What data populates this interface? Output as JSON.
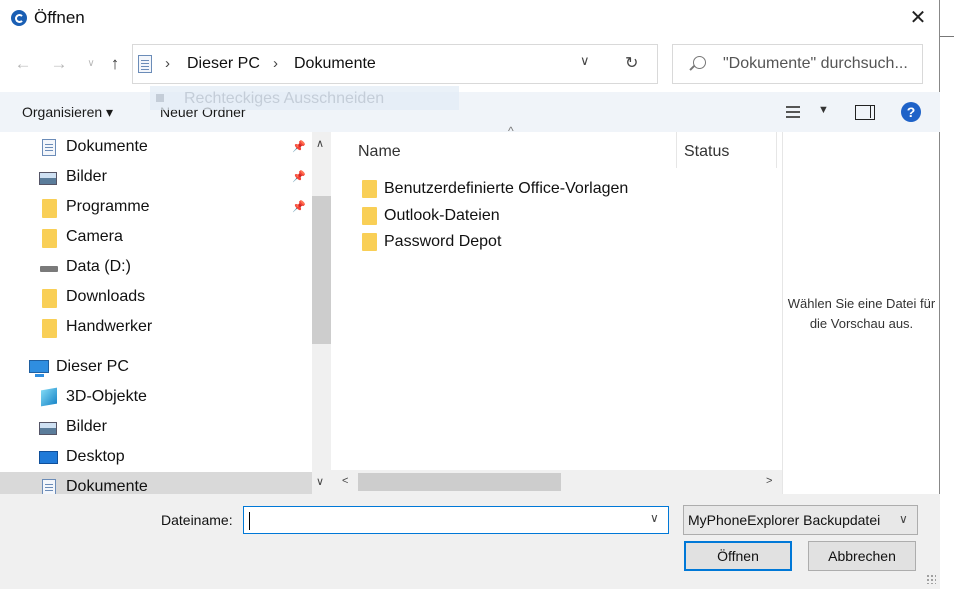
{
  "window": {
    "title": "Öffnen",
    "close_glyph": "✕"
  },
  "address": {
    "crumbs": [
      "Dieser PC",
      "Dokumente"
    ],
    "separator": "›",
    "search_placeholder": "\"Dokumente\" durchsuch..."
  },
  "toolbar": {
    "organize_label": "Organisieren ▾",
    "new_folder_label": "Neuer Ordner",
    "ghost_label": "Rechteckiges Ausschneiden",
    "help_label": "?"
  },
  "navpane": {
    "items": [
      {
        "label": "Dokumente",
        "icon": "document-icon",
        "pinned": true
      },
      {
        "label": "Bilder",
        "icon": "pictures-icon",
        "pinned": true
      },
      {
        "label": "Programme",
        "icon": "folder-icon",
        "pinned": true
      },
      {
        "label": "Camera",
        "icon": "folder-icon",
        "pinned": false
      },
      {
        "label": "Data (D:)",
        "icon": "drive-icon",
        "pinned": false
      },
      {
        "label": "Downloads",
        "icon": "folder-icon",
        "pinned": false
      },
      {
        "label": "Handwerker",
        "icon": "folder-icon",
        "pinned": false
      },
      {
        "label": "Dieser PC",
        "icon": "pc-icon",
        "pinned": false
      },
      {
        "label": "3D-Objekte",
        "icon": "cube-icon",
        "pinned": false
      },
      {
        "label": "Bilder",
        "icon": "pictures-icon",
        "pinned": false
      },
      {
        "label": "Desktop",
        "icon": "desktop-icon",
        "pinned": false
      },
      {
        "label": "Dokumente",
        "icon": "document-icon",
        "pinned": false,
        "selected": true
      }
    ]
  },
  "filelist": {
    "columns": {
      "name": "Name",
      "status": "Status"
    },
    "files": [
      "Benutzerdefinierte Office-Vorlagen",
      "Outlook-Dateien",
      "Password Depot"
    ]
  },
  "preview": {
    "text": "Wählen Sie eine Datei für die Vorschau aus."
  },
  "bottom": {
    "filename_label": "Dateiname:",
    "filename_value": "",
    "filetype_value": "MyPhoneExplorer Backupdatei",
    "open_label": "Öffnen",
    "cancel_label": "Abbrechen"
  },
  "colors": {
    "accent": "#0078d7",
    "folder": "#f9cf56",
    "toolbar_bg": "#f0f4f9"
  }
}
